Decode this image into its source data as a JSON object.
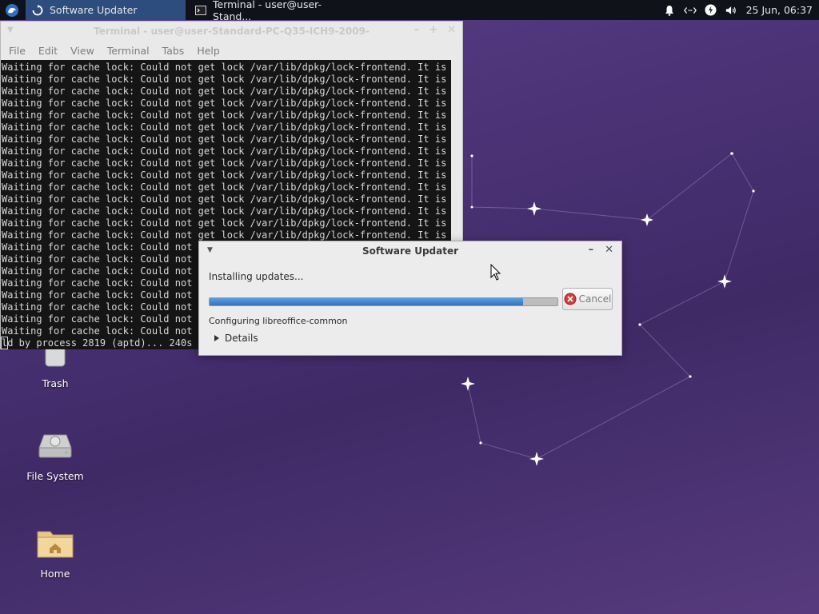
{
  "panel": {
    "tasks": [
      {
        "label": "Software Updater",
        "active": true
      },
      {
        "label": "Terminal - user@user-Stand...",
        "active": false
      }
    ],
    "clock": "25 Jun, 06:37",
    "tray_icons": [
      "bell-icon",
      "network-icon",
      "power-icon",
      "volume-icon"
    ]
  },
  "terminal": {
    "title": "Terminal - user@user-Standard-PC-Q35-ICH9-2009-",
    "menu": [
      "File",
      "Edit",
      "View",
      "Terminal",
      "Tabs",
      "Help"
    ],
    "lines_full": [
      "Waiting for cache lock: Could not get lock /var/lib/dpkg/lock-frontend. It is he",
      "Waiting for cache lock: Could not get lock /var/lib/dpkg/lock-frontend. It is he",
      "Waiting for cache lock: Could not get lock /var/lib/dpkg/lock-frontend. It is he",
      "Waiting for cache lock: Could not get lock /var/lib/dpkg/lock-frontend. It is he",
      "Waiting for cache lock: Could not get lock /var/lib/dpkg/lock-frontend. It is he",
      "Waiting for cache lock: Could not get lock /var/lib/dpkg/lock-frontend. It is he",
      "Waiting for cache lock: Could not get lock /var/lib/dpkg/lock-frontend. It is he",
      "Waiting for cache lock: Could not get lock /var/lib/dpkg/lock-frontend. It is he",
      "Waiting for cache lock: Could not get lock /var/lib/dpkg/lock-frontend. It is he",
      "Waiting for cache lock: Could not get lock /var/lib/dpkg/lock-frontend. It is he",
      "Waiting for cache lock: Could not get lock /var/lib/dpkg/lock-frontend. It is he",
      "Waiting for cache lock: Could not get lock /var/lib/dpkg/lock-frontend. It is he",
      "Waiting for cache lock: Could not get lock /var/lib/dpkg/lock-frontend. It is he",
      "Waiting for cache lock: Could not get lock /var/lib/dpkg/lock-frontend. It is he",
      "Waiting for cache lock: Could not get lock /var/lib/dpkg/lock-frontend. It is he"
    ],
    "lines_partial": [
      "Waiting for cache lock: Could not g",
      "Waiting for cache lock: Could not g",
      "Waiting for cache lock: Could not g",
      "Waiting for cache lock: Could not g",
      "Waiting for cache lock: Could not g",
      "Waiting for cache lock: Could not g",
      "Waiting for cache lock: Could not g",
      "Waiting for cache lock: Could not g"
    ],
    "last_line": "ld by process 2819 (aptd)... 240s"
  },
  "desktop_icons": [
    {
      "label": "Trash",
      "icon": "trash-icon"
    },
    {
      "label": "File System",
      "icon": "drive-icon"
    },
    {
      "label": "Home",
      "icon": "home-folder-icon"
    }
  ],
  "updater": {
    "title": "Software Updater",
    "status": "Installing updates...",
    "progress": 0.9,
    "cancel_label": "Cancel",
    "detail": "Configuring libreoffice-common",
    "details_label": "Details"
  },
  "colors": {
    "panel_bg": "#0f1219",
    "active_task": "#2c4d7d",
    "progress_fill": "#3a7fd0",
    "desktop": "#4c3377"
  }
}
